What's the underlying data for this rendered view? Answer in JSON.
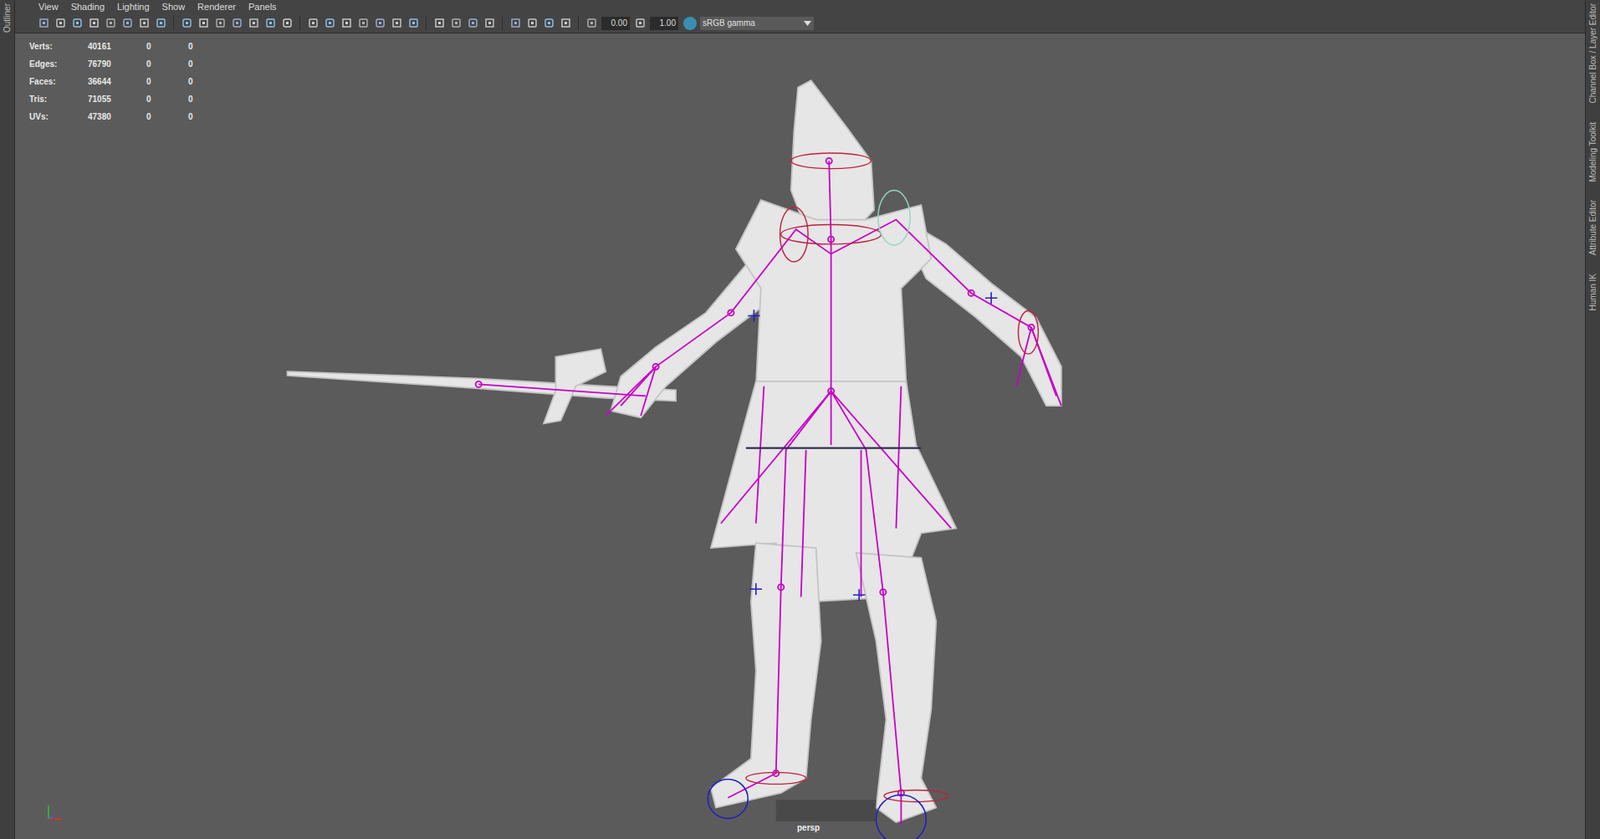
{
  "menu": [
    "View",
    "Shading",
    "Lighting",
    "Show",
    "Renderer",
    "Panels"
  ],
  "toolbar": {
    "exposure": "0.00",
    "gamma": "1.00",
    "color_space": "sRGB gamma"
  },
  "hud": {
    "rows": [
      {
        "label": "Verts:",
        "values": [
          "40161",
          "0",
          "0"
        ]
      },
      {
        "label": "Edges:",
        "values": [
          "76790",
          "0",
          "0"
        ]
      },
      {
        "label": "Faces:",
        "values": [
          "36644",
          "0",
          "0"
        ]
      },
      {
        "label": "Tris:",
        "values": [
          "71055",
          "0",
          "0"
        ]
      },
      {
        "label": "UVs:",
        "values": [
          "47380",
          "0",
          "0"
        ]
      }
    ]
  },
  "camera": "persp",
  "side_tabs": {
    "left": [
      "Outliner"
    ],
    "right": [
      "Channel Box / Layer Editor",
      "Modeling Toolkit",
      "Attribute Editor",
      "Human IK"
    ]
  }
}
